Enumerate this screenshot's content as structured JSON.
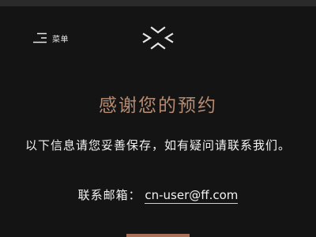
{
  "header": {
    "menu_label": "菜单",
    "menu_icon": "menu-icon",
    "logo_icon": "brand-logo-icon"
  },
  "main": {
    "title": "感谢您的预约",
    "notice": "以下信息请您妥善保存，如有疑问请联系我们。",
    "contact_label": "联系邮箱：",
    "contact_email": "cn-user@ff.com"
  },
  "colors": {
    "background": "#141414",
    "title": "#b58a72",
    "text": "#f2f2f2",
    "button": "#a8705a"
  }
}
